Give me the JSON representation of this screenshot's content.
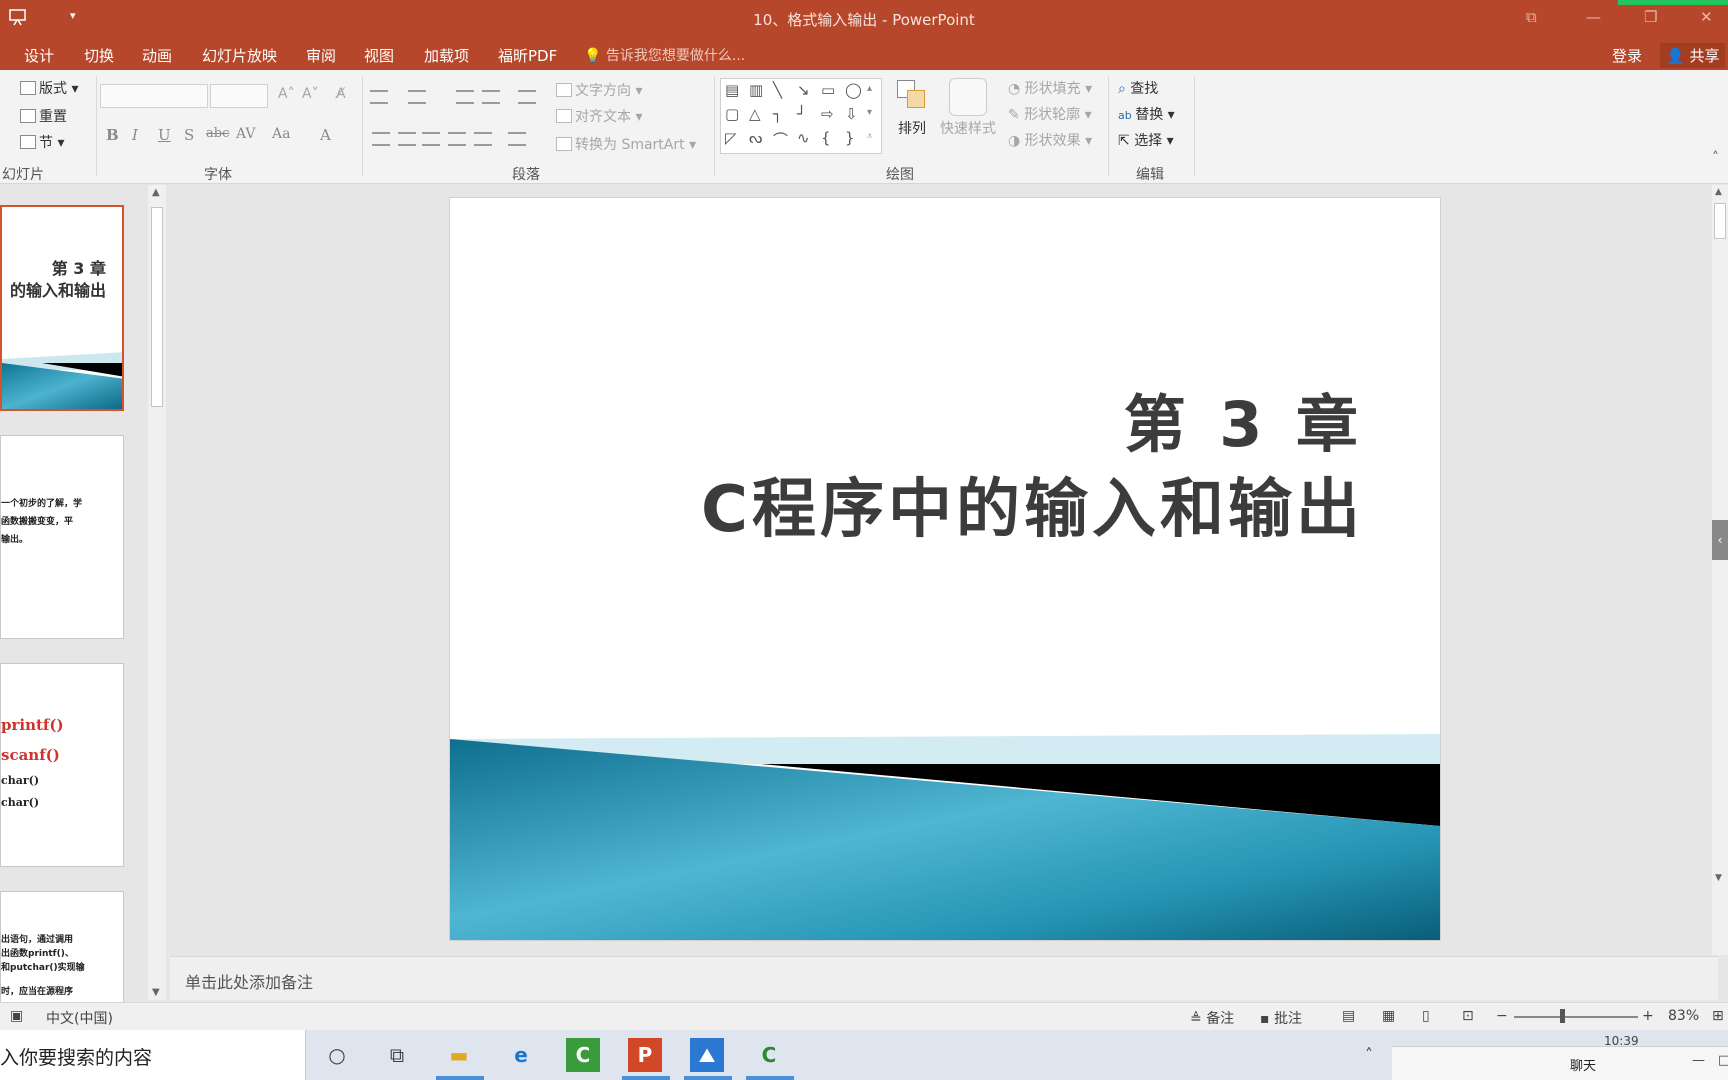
{
  "window": {
    "title": "10、格式输入输出 - PowerPoint",
    "qat_dropdown": "▾",
    "controls": [
      "⧉",
      "—",
      "❐",
      "✕"
    ]
  },
  "tabs": [
    "设计",
    "切换",
    "动画",
    "幻灯片放映",
    "审阅",
    "视图",
    "加载项",
    "福昕PDF"
  ],
  "tell_me": "告诉我您想要做什么...",
  "account": {
    "login": "登录",
    "share": "共享"
  },
  "ribbon": {
    "slides_group": {
      "label": "幻灯片",
      "layout": "版式",
      "reset": "重置",
      "section": "节"
    },
    "font_group": {
      "label": "字体",
      "buttons": [
        "B",
        "I",
        "U",
        "S",
        "abc",
        "AV",
        "Aa",
        "A"
      ]
    },
    "paragraph_group": {
      "label": "段落",
      "text_direction": "文字方向",
      "align_text": "对齐文本",
      "convert_smartart": "转换为 SmartArt"
    },
    "drawing_group": {
      "label": "绘图",
      "arrange": "排列",
      "quick_styles": "快速样式",
      "shape_fill": "形状填充",
      "shape_outline": "形状轮廓",
      "shape_effects": "形状效果"
    },
    "editing_group": {
      "label": "编辑",
      "find": "查找",
      "replace": "替换",
      "select": "选择"
    }
  },
  "slide": {
    "line1": "第 3 章",
    "line2": "C程序中的输入和输出"
  },
  "thumbnails": {
    "slide1": {
      "line1": "第 3 章",
      "line2": "的输入和输出"
    },
    "slide2": {
      "lines": [
        "一个初步的了解，学",
        "函数搬搬变变，平",
        "输出。"
      ]
    },
    "slide3": {
      "lines": [
        "printf()",
        "scanf()",
        "char()",
        "char()"
      ]
    },
    "slide4": {
      "lines": [
        "出语句，通过调用",
        "出函数printf()、",
        "和putchar()实现输",
        "时，应当在源程序"
      ]
    }
  },
  "notes": {
    "placeholder": "单击此处添加备注"
  },
  "status": {
    "language": "中文(中国)",
    "notes": "备注",
    "comments": "批注",
    "zoom": "83%",
    "zoom_level": 0.83
  },
  "taskbar": {
    "search_text": "入你要搜索的内容",
    "clock": "10:39",
    "chat": "聊天"
  },
  "colors": {
    "ppt_accent": "#b7472a",
    "slide_teal": "#1f8aa8",
    "selected_thumb": "#d4532f"
  }
}
